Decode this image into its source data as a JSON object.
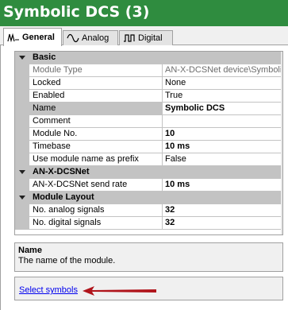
{
  "window": {
    "title": "Symbolic DCS (3)"
  },
  "tabs": [
    {
      "label": "General",
      "icon": "waveform-general-icon",
      "active": true
    },
    {
      "label": "Analog",
      "icon": "analog-wave-icon",
      "active": false
    },
    {
      "label": "Digital",
      "icon": "digital-pulse-icon",
      "active": false
    }
  ],
  "properties": {
    "basic": {
      "label": "Basic",
      "rows": [
        {
          "name": "Module Type",
          "value": "AN-X-DCSNet device\\Symbolic DCS"
        },
        {
          "name": "Locked",
          "value": "None"
        },
        {
          "name": "Enabled",
          "value": "True"
        },
        {
          "name": "Name",
          "value": "Symbolic DCS"
        },
        {
          "name": "Comment",
          "value": ""
        },
        {
          "name": "Module No.",
          "value": "10"
        },
        {
          "name": "Timebase",
          "value": "10 ms"
        },
        {
          "name": "Use module name as prefix",
          "value": "False"
        }
      ]
    },
    "anx": {
      "label": "AN-X-DCSNet",
      "rows": [
        {
          "name": "AN-X-DCSNet send rate",
          "value": "10 ms"
        }
      ]
    },
    "layout": {
      "label": "Module Layout",
      "rows": [
        {
          "name": "No. analog signals",
          "value": "32"
        },
        {
          "name": "No. digital signals",
          "value": "32"
        }
      ]
    }
  },
  "description": {
    "heading": "Name",
    "text": "The name of the module."
  },
  "commands": {
    "select_symbols": "Select symbols"
  },
  "colors": {
    "title_bar": "#2f8c3f",
    "grid_margin": "#c3c3c3",
    "link": "#0000ee",
    "arrow": "#b0141b"
  }
}
